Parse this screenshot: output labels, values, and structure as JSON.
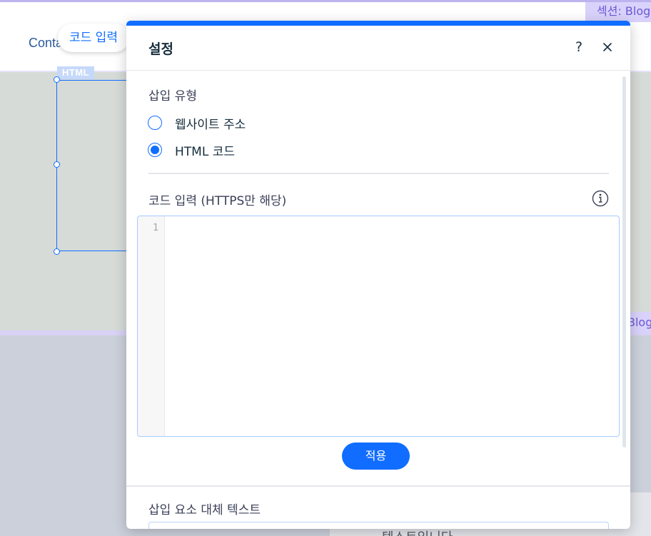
{
  "canvas": {
    "nav_contact_label": "Conta",
    "code_input_pill_label": "코드 입력",
    "section_tag_top": "섹션: Blog",
    "section_tag_side": "Blog",
    "html_element_tag": "HTML",
    "lower_card_text": "텍스트입니다"
  },
  "panel": {
    "title": "설정",
    "help_label": "?",
    "insert_type": {
      "label": "삽입 유형",
      "options": [
        {
          "label": "웹사이트 주소",
          "checked": false
        },
        {
          "label": "HTML 코드",
          "checked": true
        }
      ]
    },
    "code_editor": {
      "label": "코드 입력 (HTTPS만 해당)",
      "line_numbers": [
        "1"
      ],
      "value": ""
    },
    "apply_button_label": "적용",
    "alt_text": {
      "label": "삽입 요소 대체 텍스트",
      "value": ""
    }
  },
  "colors": {
    "accent": "#116dff",
    "section_highlight": "#d9d2fb",
    "text_primary": "#162d3d"
  }
}
